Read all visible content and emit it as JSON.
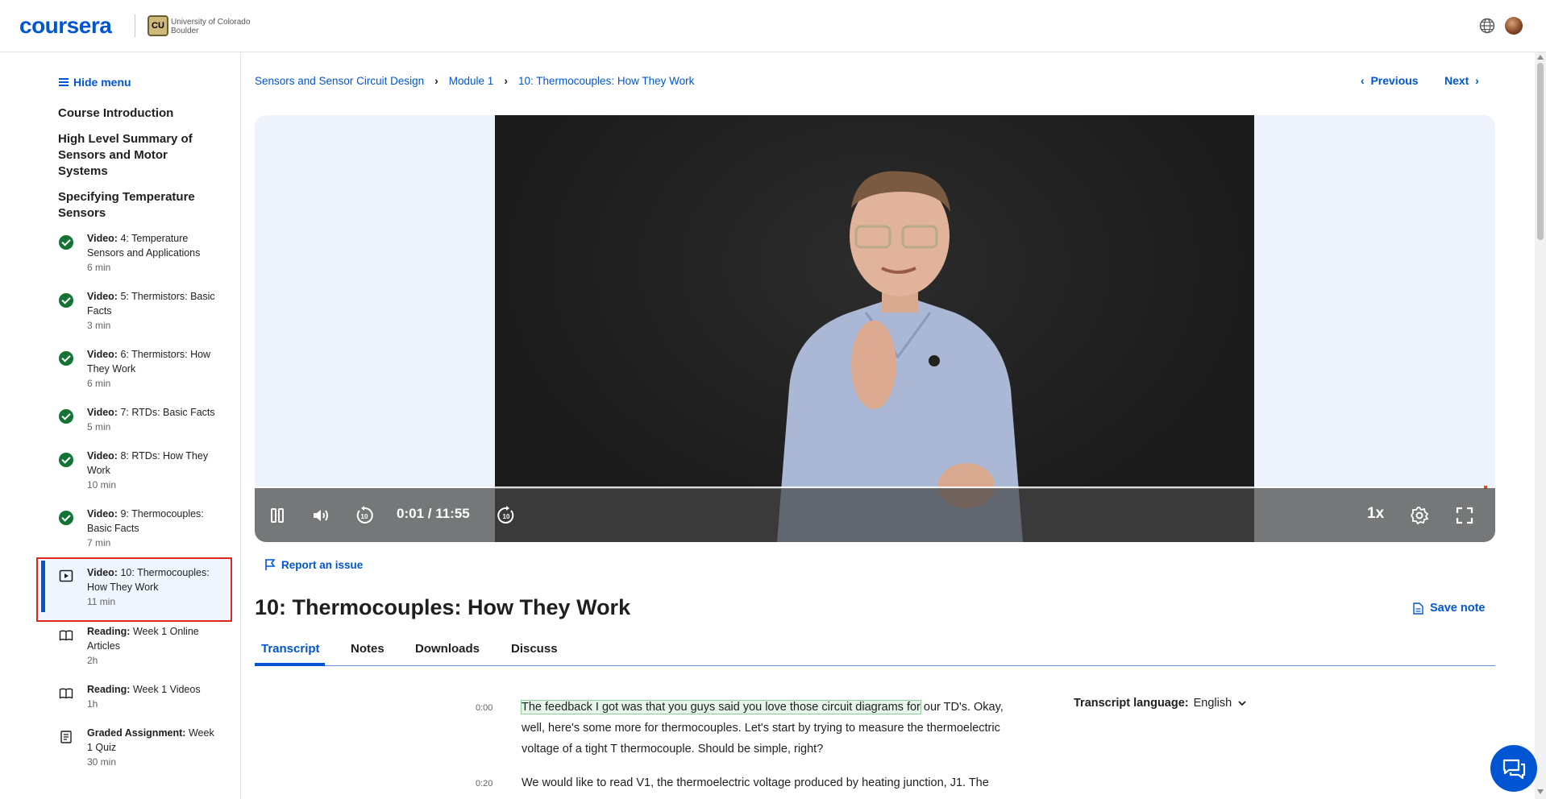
{
  "header": {
    "logo": "coursera",
    "partner_mark": "CU",
    "partner_name_line1": "University of Colorado",
    "partner_name_line2": "Boulder",
    "icons": [
      "globe-icon",
      "avatar"
    ]
  },
  "sidebar": {
    "hide_menu_label": "Hide menu",
    "sections": [
      {
        "title": "Course Introduction"
      },
      {
        "title": "High Level Summary of Sensors and Motor Systems"
      },
      {
        "title": "Specifying Temperature Sensors"
      }
    ],
    "items": [
      {
        "type": "Video:",
        "title": "4: Temperature Sensors and Applications",
        "duration": "6 min",
        "status": "completed",
        "icon": "check-icon"
      },
      {
        "type": "Video:",
        "title": "5: Thermistors: Basic Facts",
        "duration": "3 min",
        "status": "completed",
        "icon": "check-icon"
      },
      {
        "type": "Video:",
        "title": "6: Thermistors: How They Work",
        "duration": "6 min",
        "status": "completed",
        "icon": "check-icon"
      },
      {
        "type": "Video:",
        "title": "7: RTDs: Basic Facts",
        "duration": "5 min",
        "status": "completed",
        "icon": "check-icon"
      },
      {
        "type": "Video:",
        "title": "8: RTDs: How They Work",
        "duration": "10 min",
        "status": "completed",
        "icon": "check-icon"
      },
      {
        "type": "Video:",
        "title": "9: Thermocouples: Basic Facts",
        "duration": "7 min",
        "status": "completed",
        "icon": "check-icon"
      },
      {
        "type": "Video:",
        "title": "10: Thermocouples: How They Work",
        "duration": "11 min",
        "status": "current",
        "icon": "play-icon"
      },
      {
        "type": "Reading:",
        "title": "Week 1 Online Articles",
        "duration": "2h",
        "status": "pending",
        "icon": "book-icon"
      },
      {
        "type": "Reading:",
        "title": "Week 1 Videos",
        "duration": "1h",
        "status": "pending",
        "icon": "book-icon"
      },
      {
        "type": "Graded Assignment:",
        "title": "Week 1 Quiz",
        "duration": "30 min",
        "status": "pending",
        "icon": "assignment-icon"
      }
    ]
  },
  "breadcrumb": [
    "Sensors and Sensor Circuit Design",
    "Module 1",
    "10: Thermocouples: How They Work"
  ],
  "nav": {
    "previous": "Previous",
    "next": "Next"
  },
  "player": {
    "time": "0:01 / 11:55",
    "speed": "1x",
    "progress": 0.0014,
    "controls": [
      "pause-icon",
      "volume-icon",
      "rewind-10-icon",
      "forward-10-icon",
      "settings-icon",
      "fullscreen-icon"
    ]
  },
  "report_issue": "Report an issue",
  "video_title": "10: Thermocouples: How They Work",
  "save_note": "Save note",
  "tabs": [
    "Transcript",
    "Notes",
    "Downloads",
    "Discuss"
  ],
  "active_tab": "Transcript",
  "transcript": {
    "language_label": "Transcript language:",
    "language_value": "English",
    "lines": [
      {
        "time": "0:00",
        "highlight": "The feedback I got was that you guys said you love those circuit diagrams for",
        "text": " our TD's. Okay, well, here's some more for thermocouples. Let's start by trying to measure the thermoelectric voltage of a tight T thermocouple. Should be simple, right?"
      },
      {
        "time": "0:20",
        "highlight": "",
        "text": "We would like to read V1, the thermoelectric voltage produced by heating junction, J1. The"
      }
    ]
  },
  "colors": {
    "brand": "#0056d2",
    "complete": "#137333",
    "highlight_outline": "#e0261c"
  }
}
